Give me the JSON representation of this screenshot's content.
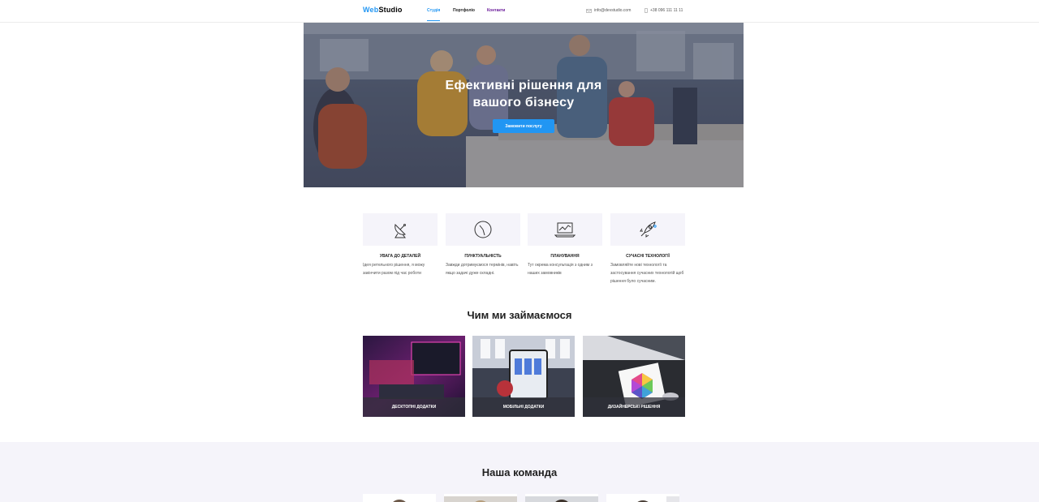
{
  "header": {
    "logo_part1": "Web",
    "logo_part2": "Studio",
    "nav": [
      "Студія",
      "Портфоліо",
      "Контакти"
    ],
    "email": "info@devstudio.com",
    "phone": "+38 096 111 11 11",
    "icons": {
      "email": "mail-icon",
      "phone": "phone-icon"
    }
  },
  "hero": {
    "title_line1": "Ефективні рішення для",
    "title_line2": "вашого бізнесу",
    "button": "Замовити послугу"
  },
  "features": [
    {
      "title": "Увага до деталей",
      "text": "Ідея ретельного рішення, я можу закінчити разом під час роботи",
      "icon": "antenna-icon"
    },
    {
      "title": "Пунктуальність",
      "text": "Завжди дотримуємося термінів, навіть якщо задачі дуже складні.",
      "icon": "clock-icon"
    },
    {
      "title": "Планування",
      "text": "Тут окрема консультація з одним з наших замовників",
      "icon": "laptop-chart-icon"
    },
    {
      "title": "Сучасні технології",
      "text": "Замовляйте нові технології та застосування сучасних технологій щоб рішення було сучасним.",
      "icon": "rocket-icon"
    }
  ],
  "services": {
    "title": "Чим ми займаємося",
    "items": [
      {
        "label": "Десктопні додатки"
      },
      {
        "label": "Мобільні додатки"
      },
      {
        "label": "Дизайнерські рішення"
      }
    ]
  },
  "team": {
    "title": "Наша команда"
  },
  "colors": {
    "accent": "#2196f3",
    "visited": "#6a1b9a",
    "card_bg": "#f5f4fa",
    "label_bg": "#2f303a"
  }
}
